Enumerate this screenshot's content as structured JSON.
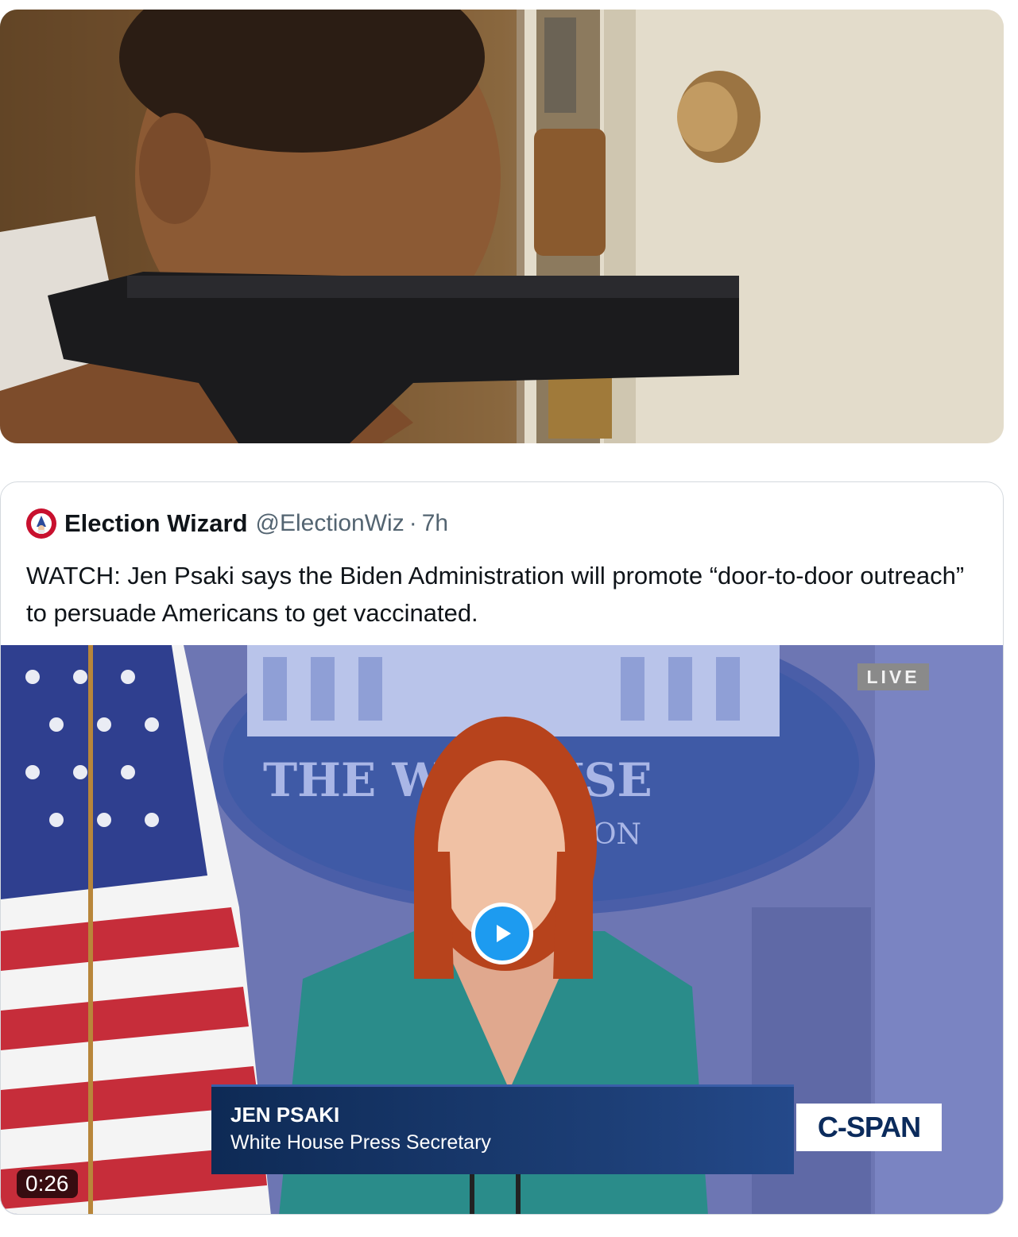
{
  "top_media": {
    "icon": "photo-man-aiming-pistol-through-door"
  },
  "quote": {
    "author_name": "Election Wizard",
    "author_handle": "@ElectionWiz",
    "separator": "·",
    "time": "7h",
    "avatar_icon": "wizard-avatar-icon",
    "text": "WATCH: Jen Psaki says the Biden Administration will promote “door-to-door outreach” to persuade Americans to get vaccinated."
  },
  "video": {
    "live_label": "LIVE",
    "backdrop_text": "THE W HOUSE",
    "backdrop_subtext": "ON",
    "lower_third_name": "JEN PSAKI",
    "lower_third_title": "White House Press Secretary",
    "network_logo": "C-SPAN",
    "duration": "0:26",
    "play_icon": "play-icon"
  },
  "colors": {
    "accent": "#1d9bf0",
    "text": "#0f1419",
    "secondary_text": "#536471"
  }
}
